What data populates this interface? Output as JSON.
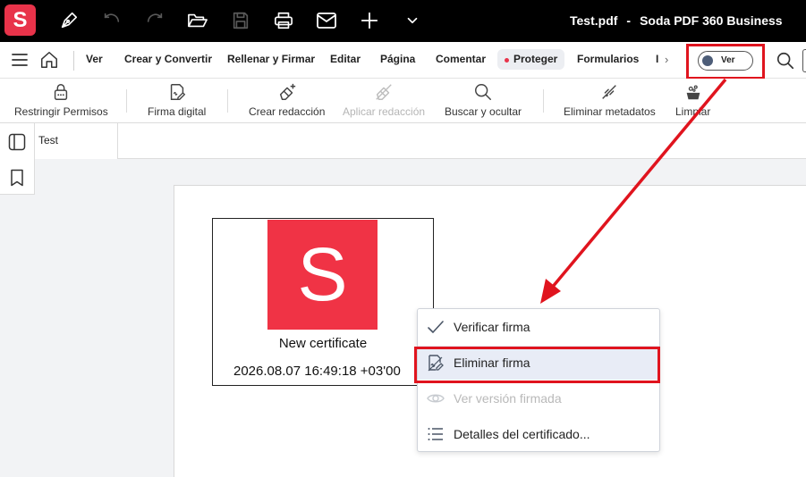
{
  "app": {
    "logo_letter": "S",
    "file_name": "Test.pdf",
    "separator": "-",
    "product_name": "Soda PDF 360 Business",
    "brand_color": "#e8334a",
    "highlight_color": "#e0141e"
  },
  "titlebar_icons": [
    "pen-icon",
    "undo-icon",
    "redo-icon",
    "folder-open-icon",
    "save-icon",
    "print-icon",
    "mail-icon",
    "plus-icon",
    "chevron-down-icon"
  ],
  "menu": {
    "items": [
      "Ver",
      "Crear y Convertir",
      "Rellenar y Firmar",
      "Editar",
      "Página",
      "Comentar",
      "Proteger",
      "Formularios",
      "I"
    ],
    "active": "Proteger",
    "more_arrow": "›",
    "toggle_label": "Ver"
  },
  "ribbon": {
    "items": [
      {
        "label": "Restringir Permisos",
        "icon": "lock-icon",
        "enabled": true
      },
      {
        "label": "Firma digital",
        "icon": "digital-signature-icon",
        "enabled": true
      },
      {
        "label": "Crear redacción",
        "icon": "create-redaction-icon",
        "enabled": true
      },
      {
        "label": "Aplicar redacción",
        "icon": "apply-redaction-icon",
        "enabled": false
      },
      {
        "label": "Buscar y ocultar",
        "icon": "search-icon",
        "enabled": true
      },
      {
        "label": "Eliminar metadatos",
        "icon": "remove-metadata-icon",
        "enabled": true
      },
      {
        "label": "Limpiar",
        "icon": "clean-icon",
        "enabled": true
      }
    ]
  },
  "tabs": [
    {
      "label": "Test"
    }
  ],
  "signature": {
    "logo_letter": "S",
    "name": "New certificate",
    "date": "2026.08.07 16:49:18 +03'00"
  },
  "context_menu": {
    "items": [
      {
        "label": "Verificar firma",
        "icon": "check-icon",
        "enabled": true
      },
      {
        "label": "Eliminar firma",
        "icon": "remove-signature-icon",
        "enabled": true,
        "highlighted": true
      },
      {
        "label": "Ver versión firmada",
        "icon": "eye-icon",
        "enabled": false
      },
      {
        "label": "Detalles del certificado...",
        "icon": "list-icon",
        "enabled": true
      }
    ]
  }
}
